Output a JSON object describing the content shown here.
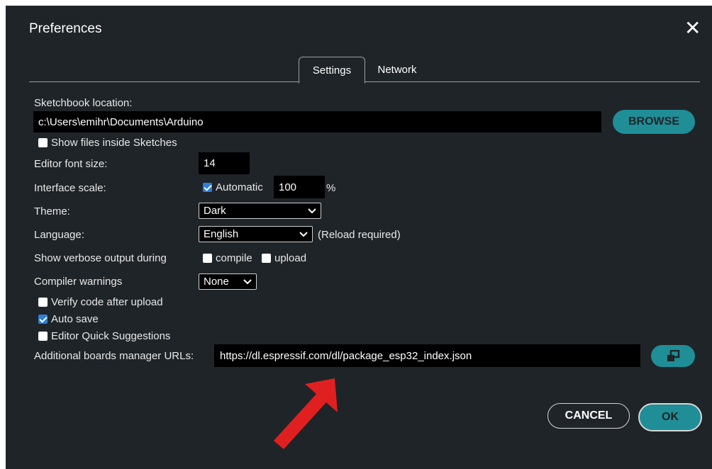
{
  "dialog": {
    "title": "Preferences",
    "close_glyph": "✕"
  },
  "tabs": [
    {
      "label": "Settings",
      "active": true
    },
    {
      "label": "Network",
      "active": false
    }
  ],
  "sketchbook": {
    "label": "Sketchbook location:",
    "value": "c:\\Users\\emihr\\Documents\\Arduino",
    "browse_label": "BROWSE"
  },
  "show_files": {
    "label": "Show files inside Sketches",
    "checked": false
  },
  "font_size": {
    "label": "Editor font size:",
    "value": "14"
  },
  "interface_scale": {
    "label": "Interface scale:",
    "automatic_label": "Automatic",
    "automatic_checked": true,
    "value": "100",
    "unit": "%"
  },
  "theme": {
    "label": "Theme:",
    "value": "Dark"
  },
  "language": {
    "label": "Language:",
    "value": "English",
    "note": "(Reload required)"
  },
  "verbose": {
    "label": "Show verbose output during",
    "compile_label": "compile",
    "compile_checked": false,
    "upload_label": "upload",
    "upload_checked": false
  },
  "compiler_warnings": {
    "label": "Compiler warnings",
    "value": "None"
  },
  "verify_code": {
    "label": "Verify code after upload",
    "checked": false
  },
  "auto_save": {
    "label": "Auto save",
    "checked": true
  },
  "quick_suggestions": {
    "label": "Editor Quick Suggestions",
    "checked": false
  },
  "boards_urls": {
    "label": "Additional boards manager URLs:",
    "value": "https://dl.espressif.com/dl/package_esp32_index.json",
    "button_icon": "open-window-icon"
  },
  "footer": {
    "cancel_label": "CANCEL",
    "ok_label": "OK"
  },
  "colors": {
    "dialog_bg": "#1f2428",
    "accent": "#1f8e97",
    "arrow": "#e02020"
  }
}
